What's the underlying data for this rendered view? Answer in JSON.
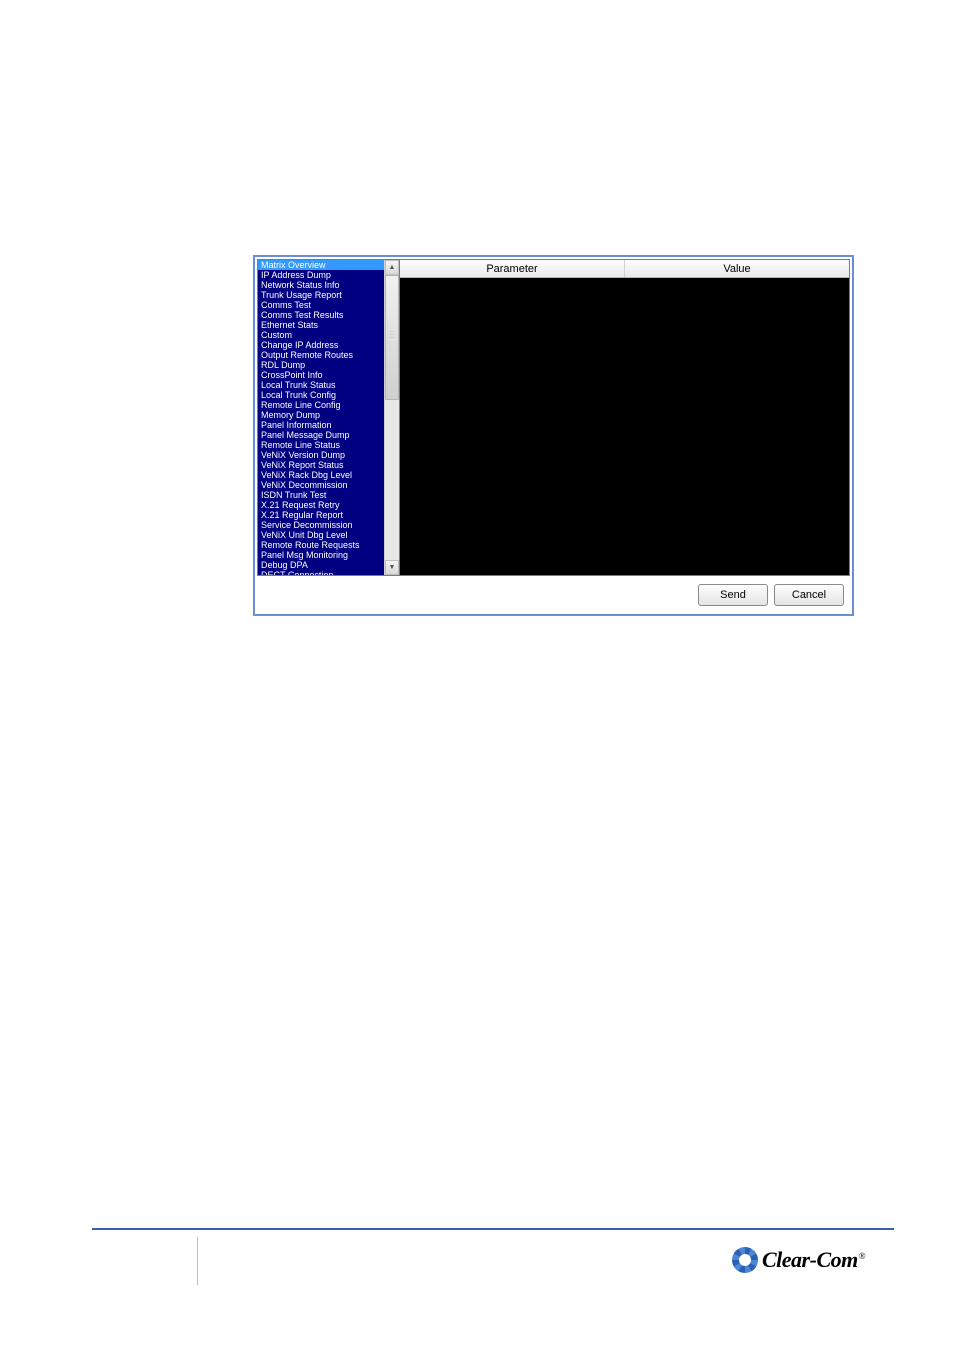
{
  "dialog": {
    "list": {
      "items": [
        "Matrix Overview",
        "IP Address Dump",
        "Network Status Info",
        "Trunk Usage Report",
        "Comms Test",
        "Comms Test Results",
        "Ethernet Stats",
        "Custom",
        "Change IP Address",
        "Output Remote Routes",
        "RDL Dump",
        "CrossPoint Info",
        "Local Trunk Status",
        "Local Trunk Config",
        "Remote Line Config",
        "Memory Dump",
        "Panel Information",
        "Panel Message Dump",
        "Remote Line Status",
        "VeNiX Version Dump",
        "VeNiX Report Status",
        "VeNiX Rack Dbg Level",
        "VeNiX Decommission",
        "ISDN Trunk Test",
        "X.21 Request Retry",
        "X.21 Regular Report",
        "Service Decommission",
        "VeNiX Unit Dbg Level",
        "Remote Route Requests",
        "Panel Msg Monitoring",
        "Debug DPA",
        "DECT Connection"
      ],
      "selected_index": 0
    },
    "columns": {
      "parameter": "Parameter",
      "value": "Value"
    },
    "buttons": {
      "send": "Send",
      "cancel": "Cancel"
    }
  },
  "footer": {
    "brand": "Clear-Com",
    "registered": "®"
  }
}
